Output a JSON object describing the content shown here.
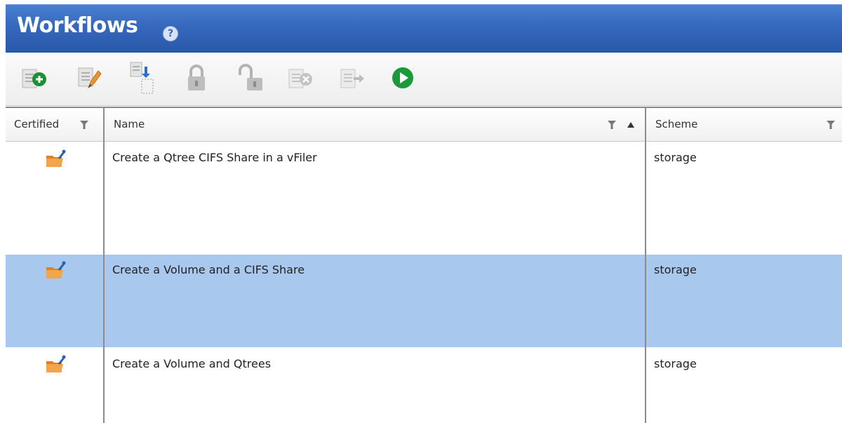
{
  "title": "Workflows",
  "help_glyph": "?",
  "toolbar": {
    "buttons": [
      {
        "icon": "new-workflow-icon"
      },
      {
        "icon": "edit-workflow-icon"
      },
      {
        "icon": "clone-workflow-icon"
      },
      {
        "icon": "lock-icon"
      },
      {
        "icon": "unlock-icon"
      },
      {
        "icon": "delete-workflow-icon"
      },
      {
        "icon": "export-icon"
      },
      {
        "icon": "execute-icon"
      }
    ]
  },
  "columns": {
    "certified": "Certified",
    "name": "Name",
    "scheme": "Scheme"
  },
  "rows": [
    {
      "name": "Create a Qtree CIFS Share in a vFiler",
      "scheme": "storage",
      "certified_icon": "certified-folder-icon",
      "selected": false
    },
    {
      "name": "Create a Volume and a CIFS Share",
      "scheme": "storage",
      "certified_icon": "certified-folder-icon",
      "selected": true
    },
    {
      "name": "Create a Volume and Qtrees",
      "scheme": "storage",
      "certified_icon": "certified-folder-icon",
      "selected": false
    }
  ],
  "colors": {
    "title_bar": "#3568bd",
    "selected_row": "#a9c8ee",
    "execute_green": "#1a9a3a"
  }
}
